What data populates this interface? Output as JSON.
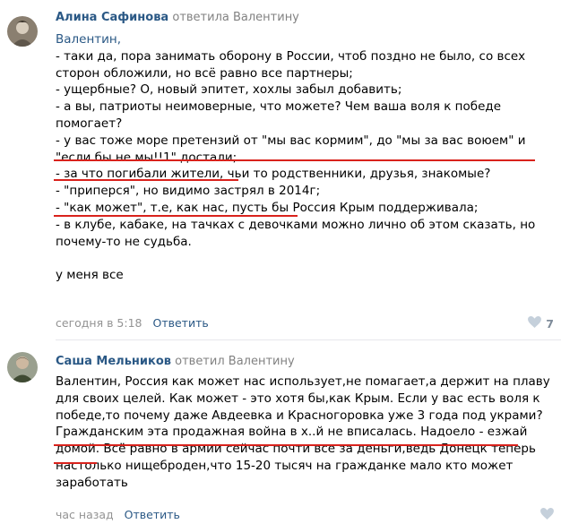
{
  "comments": [
    {
      "author": "Алина Сафинова",
      "action": "ответила Валентину",
      "mention": "Валентин,",
      "lines": [
        "- таки да, пора занимать оборону в России, чтоб поздно не было, со всех",
        "сторон обложили, но всё равно все партнеры;",
        "- ущербные? О, новый эпитет, хохлы забыл добавить;",
        "- а вы, патриоты неимоверные, что можете? Чем ваша воля к победе",
        "помогает?",
        "- у вас тоже море претензий от \"мы вас кормим\", до \"мы за вас воюем\" и",
        "\"если бы не мы!!1\" достали;",
        "- за что погибали жители, чьи то родственники, друзья, знакомые?",
        "- \"приперся\", но видимо застрял в 2014г;",
        "- \"как может\", т.е, как нас, пусть бы Россия Крым поддерживала;",
        "- в клубе, кабаке, на тачках с девочками можно лично об этом сказать, но",
        "почему-то не судьба.",
        "",
        "у меня все"
      ],
      "time": "сегодня в 5:18",
      "reply_label": "Ответить",
      "likes": "7",
      "avatar_icon": "user-avatar-photo"
    },
    {
      "author": "Саша Мельников",
      "action": "ответил Валентину",
      "lines": [
        "Валентин, Россия как может нас использует,не помагает,а держит на плаву",
        "для своих целей. Как может - это хотя бы,как Крым. Если у вас есть воля к",
        "победе,то почему даже Авдеевка и Красногоровка уже 3 года под украми?",
        "Гражданским эта продажная война в х..й не вписалась. Надоело - езжай",
        "домой. Всё равно в армии сейчас почти все за деньги,ведь Донецк теперь",
        "настолько нищеброден,что 15-20 тысяч на гражданке мало кто может",
        "заработать"
      ],
      "time": "час назад",
      "reply_label": "Ответить",
      "likes": "",
      "avatar_icon": "user-avatar-photo"
    }
  ],
  "colors": {
    "link": "#2a5885",
    "muted": "#828282",
    "underline": "#d9221c",
    "divider": "#e7e8ec"
  },
  "icons": {
    "like": "heart-icon"
  }
}
